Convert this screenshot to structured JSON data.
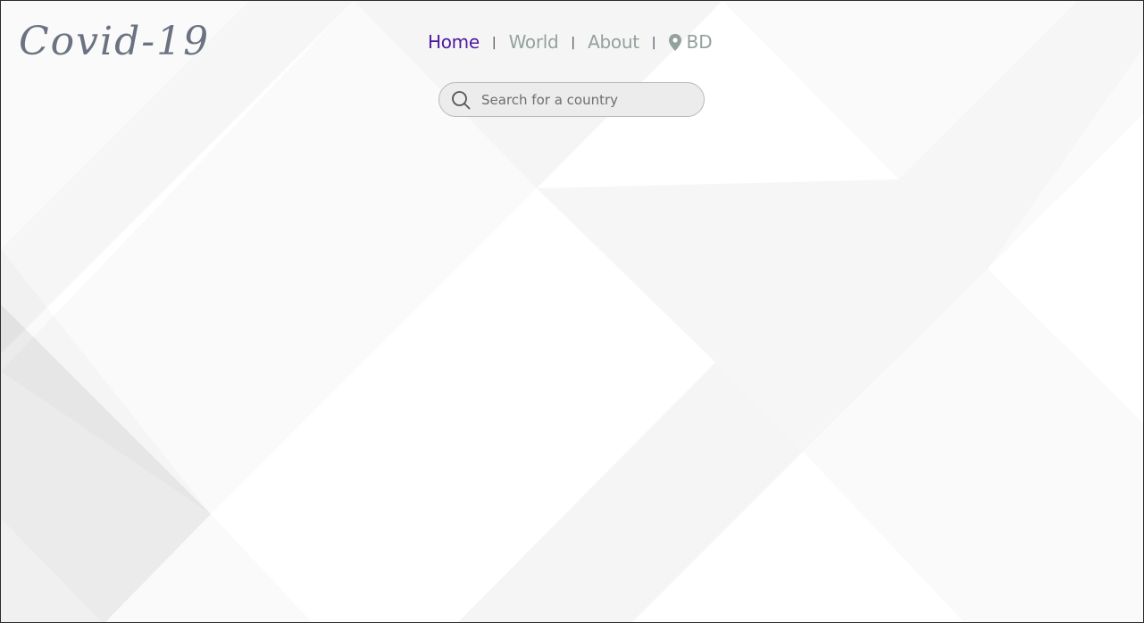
{
  "logo": {
    "text": "Covid-19"
  },
  "nav": {
    "home": "Home",
    "world": "World",
    "about": "About",
    "separator": "|",
    "location": "BD"
  },
  "search": {
    "placeholder": "Search for a country",
    "value": ""
  },
  "icons": {
    "search": "search-icon",
    "location": "map-pin-icon"
  },
  "colors": {
    "active_nav": "#4f1aa0",
    "nav": "#93a29b",
    "logo": "#6b7382"
  }
}
